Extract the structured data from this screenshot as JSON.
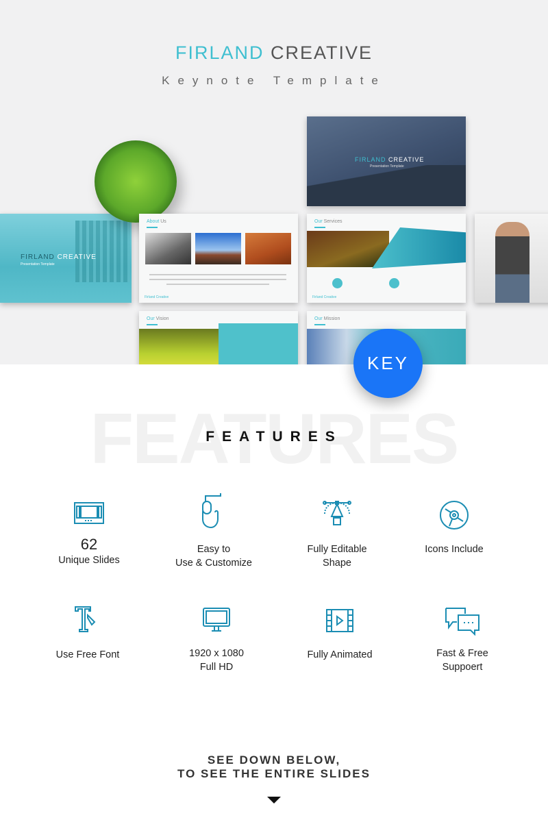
{
  "header": {
    "title_accent": "FIRLAND",
    "title_rest": " CREATIVE",
    "subtitle": "Keynote Template"
  },
  "slides": {
    "cover_title_accent": "FIRLAND",
    "cover_title_rest": " CREATIVE",
    "cover_subtitle": "Presentation Template",
    "about": {
      "accent": "About",
      "rest": " Us",
      "footer": "Firland Creative"
    },
    "services": {
      "accent": "Our",
      "rest": " Services",
      "footer": "Firland Creative"
    },
    "vision": {
      "accent": "Our",
      "rest": " Vision"
    },
    "mission": {
      "accent": "Our",
      "rest": " Mission"
    }
  },
  "badge": "KEY",
  "features": {
    "watermark": "FEATURES",
    "title": "FEATURES",
    "items": [
      {
        "icon": "slides-icon",
        "line1": "62",
        "line2": "Unique Slides"
      },
      {
        "icon": "mouse-hand-icon",
        "line1": "Easy to",
        "line2": "Use & Customize"
      },
      {
        "icon": "pen-tool-icon",
        "line1": "Fully Editable",
        "line2": "Shape"
      },
      {
        "icon": "disc-icon",
        "line1": "Icons Include",
        "line2": ""
      },
      {
        "icon": "font-icon",
        "line1": "Use Free Font",
        "line2": ""
      },
      {
        "icon": "monitor-icon",
        "line1": "1920 x 1080",
        "line2": "Full HD"
      },
      {
        "icon": "film-icon",
        "line1": "Fully Animated",
        "line2": ""
      },
      {
        "icon": "chat-icon",
        "line1": "Fast & Free",
        "line2": "Suppoert"
      }
    ]
  },
  "cta": {
    "line1": "SEE DOWN BELOW,",
    "line2": "TO SEE THE ENTIRE SLIDES"
  },
  "colors": {
    "accent": "#3fbfd0",
    "icon": "#1b8db3",
    "badge": "#1a75f7"
  }
}
